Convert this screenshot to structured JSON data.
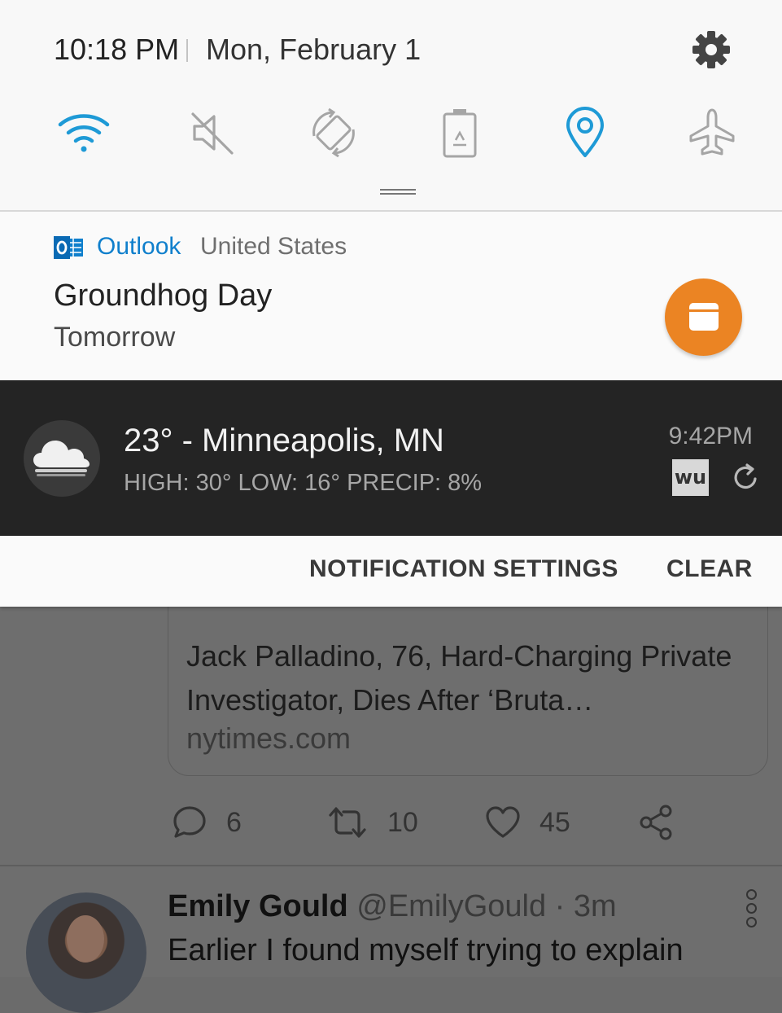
{
  "status_bar": {
    "time": "10:18 PM",
    "date": "Mon, February 1",
    "settings_icon": "gear-icon"
  },
  "quick_settings": [
    {
      "name": "wifi",
      "icon": "wifi-icon",
      "active": true
    },
    {
      "name": "sound",
      "icon": "mute-icon",
      "active": false
    },
    {
      "name": "auto-rotate",
      "icon": "rotate-icon",
      "active": false
    },
    {
      "name": "power-saving",
      "icon": "battery-recycle-icon",
      "active": false
    },
    {
      "name": "location",
      "icon": "location-pin-icon",
      "active": true
    },
    {
      "name": "airplane-mode",
      "icon": "airplane-icon",
      "active": false
    }
  ],
  "colors": {
    "accent": "#1e9ad6",
    "inactive_icon": "#a5a5a5",
    "outlook_blue": "#0f7fcc",
    "action_orange": "#eb8423",
    "weather_bg": "#242424"
  },
  "outlook_notification": {
    "app": "Outlook",
    "sub": "United States",
    "title": "Groundhog Day",
    "text": "Tomorrow",
    "action_icon": "calendar-icon"
  },
  "weather_notification": {
    "title": "23° - Minneapolis, MN",
    "details": "HIGH: 30° LOW: 16° PRECIP: 8%",
    "time": "9:42PM",
    "logo": "wu",
    "icon": "cloud-icon"
  },
  "shade_actions": {
    "settings": "NOTIFICATION SETTINGS",
    "clear": "CLEAR"
  },
  "feed": {
    "link_card": {
      "title": "Jack Palladino, 76, Hard-Charging Private Investigator, Dies After ‘Bruta…",
      "domain": "nytimes.com"
    },
    "actions": {
      "replies": "6",
      "retweets": "10",
      "likes": "45"
    },
    "next_tweet": {
      "name": "Emily Gould",
      "handle": "@EmilyGould · 3m",
      "text": "Earlier I found myself trying to explain"
    }
  }
}
